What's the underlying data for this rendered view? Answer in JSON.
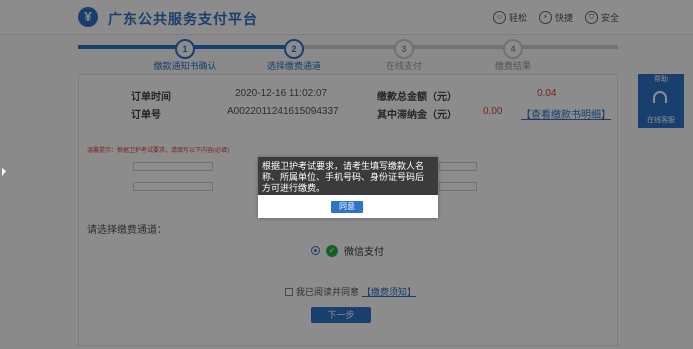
{
  "header": {
    "logo_symbol": "¥",
    "title": "广东公共服务支付平台",
    "actions": [
      {
        "icon": "smile-icon",
        "glyph": "☺",
        "label": "轻松"
      },
      {
        "icon": "lightning-icon",
        "glyph": "⚡",
        "label": "快捷"
      },
      {
        "icon": "shield-icon",
        "glyph": "⛉",
        "label": "安全"
      }
    ]
  },
  "steps": [
    {
      "num": "1",
      "label": "缴款通知书确认",
      "state": "done"
    },
    {
      "num": "2",
      "label": "选择缴费通道",
      "state": "current"
    },
    {
      "num": "3",
      "label": "在线支付",
      "state": "todo"
    },
    {
      "num": "4",
      "label": "缴费结果",
      "state": "todo"
    }
  ],
  "order": {
    "time_label": "订单时间",
    "time_value": "2020-12-16 11:02:07",
    "number_label": "订单号",
    "number_value": "A0022011241615094337",
    "total_label": "缴款总金额（元）",
    "total_value": "0.04",
    "fee_label": "其中滞纳金（元）",
    "fee_value": "0.00",
    "detail_link": "【查看缴款书明细】"
  },
  "form": {
    "notice": "温馨提示：根据卫护考试要求，请填写以下内容(必填)"
  },
  "payment": {
    "section_title": "请选择缴费通道：",
    "option_label": "微信支付",
    "agree_prefix": "我已阅读并同意",
    "agree_link": "【缴费须知】",
    "next_label": "下一步"
  },
  "service": {
    "tab_label": "帮助",
    "label": "在线客服"
  },
  "modal": {
    "message": "根据卫护考试要求，请考生填写缴款人名称、所属单位、手机号码、身份证号码后方可进行缴费。",
    "button_label": "同意"
  },
  "colors": {
    "accent": "#2f73c9",
    "amount": "#e04040",
    "wechat": "#22b14c"
  }
}
